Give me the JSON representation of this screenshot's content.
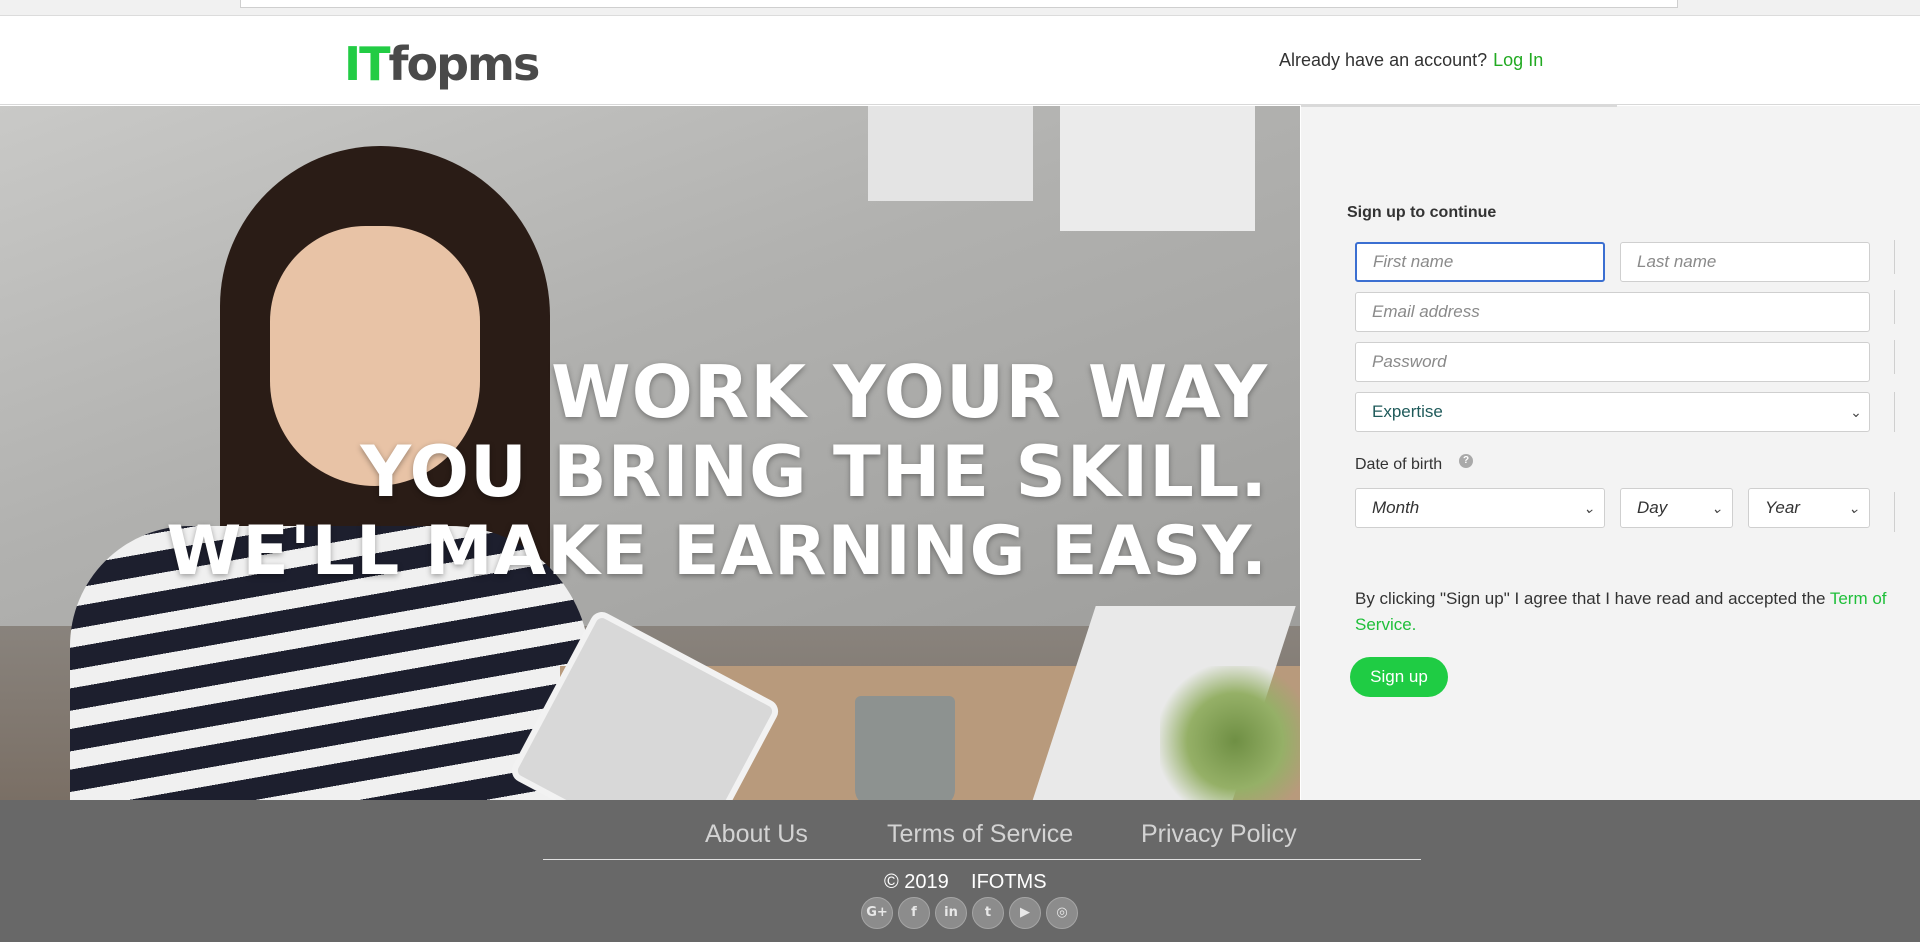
{
  "header": {
    "logo_prefix": "IT",
    "logo_suffix": "fopms",
    "account_prompt": "Already have an account?",
    "login_label": "Log In"
  },
  "hero": {
    "line1": "WORK YOUR WAY",
    "line2": "YOU BRING THE SKILL.",
    "line3": "WE'LL MAKE EARNING EASY."
  },
  "form": {
    "title": "Sign up to continue",
    "first_name_placeholder": "First name",
    "last_name_placeholder": "Last name",
    "email_placeholder": "Email address",
    "password_placeholder": "Password",
    "expertise_value": "Expertise",
    "dob_label": "Date of birth",
    "help_glyph": "?",
    "month_value": "Month",
    "day_value": "Day",
    "year_value": "Year",
    "terms_text": "By clicking \"Sign up\" I agree that I have read and accepted the ",
    "terms_link": "Term of Service.",
    "signup_label": "Sign up",
    "focus_color": "#3b6fd1",
    "accent_color": "#1fcc44"
  },
  "footer": {
    "links": [
      "About Us",
      "Terms of Service",
      "Privacy Policy"
    ],
    "copyright": "© 2019    IFOTMS",
    "socials": [
      {
        "name": "google-plus-icon",
        "glyph": "G+"
      },
      {
        "name": "facebook-icon",
        "glyph": "f"
      },
      {
        "name": "linkedin-icon",
        "glyph": "in"
      },
      {
        "name": "twitter-icon",
        "glyph": "t"
      },
      {
        "name": "youtube-icon",
        "glyph": "▶"
      },
      {
        "name": "instagram-icon",
        "glyph": "◎"
      }
    ]
  }
}
